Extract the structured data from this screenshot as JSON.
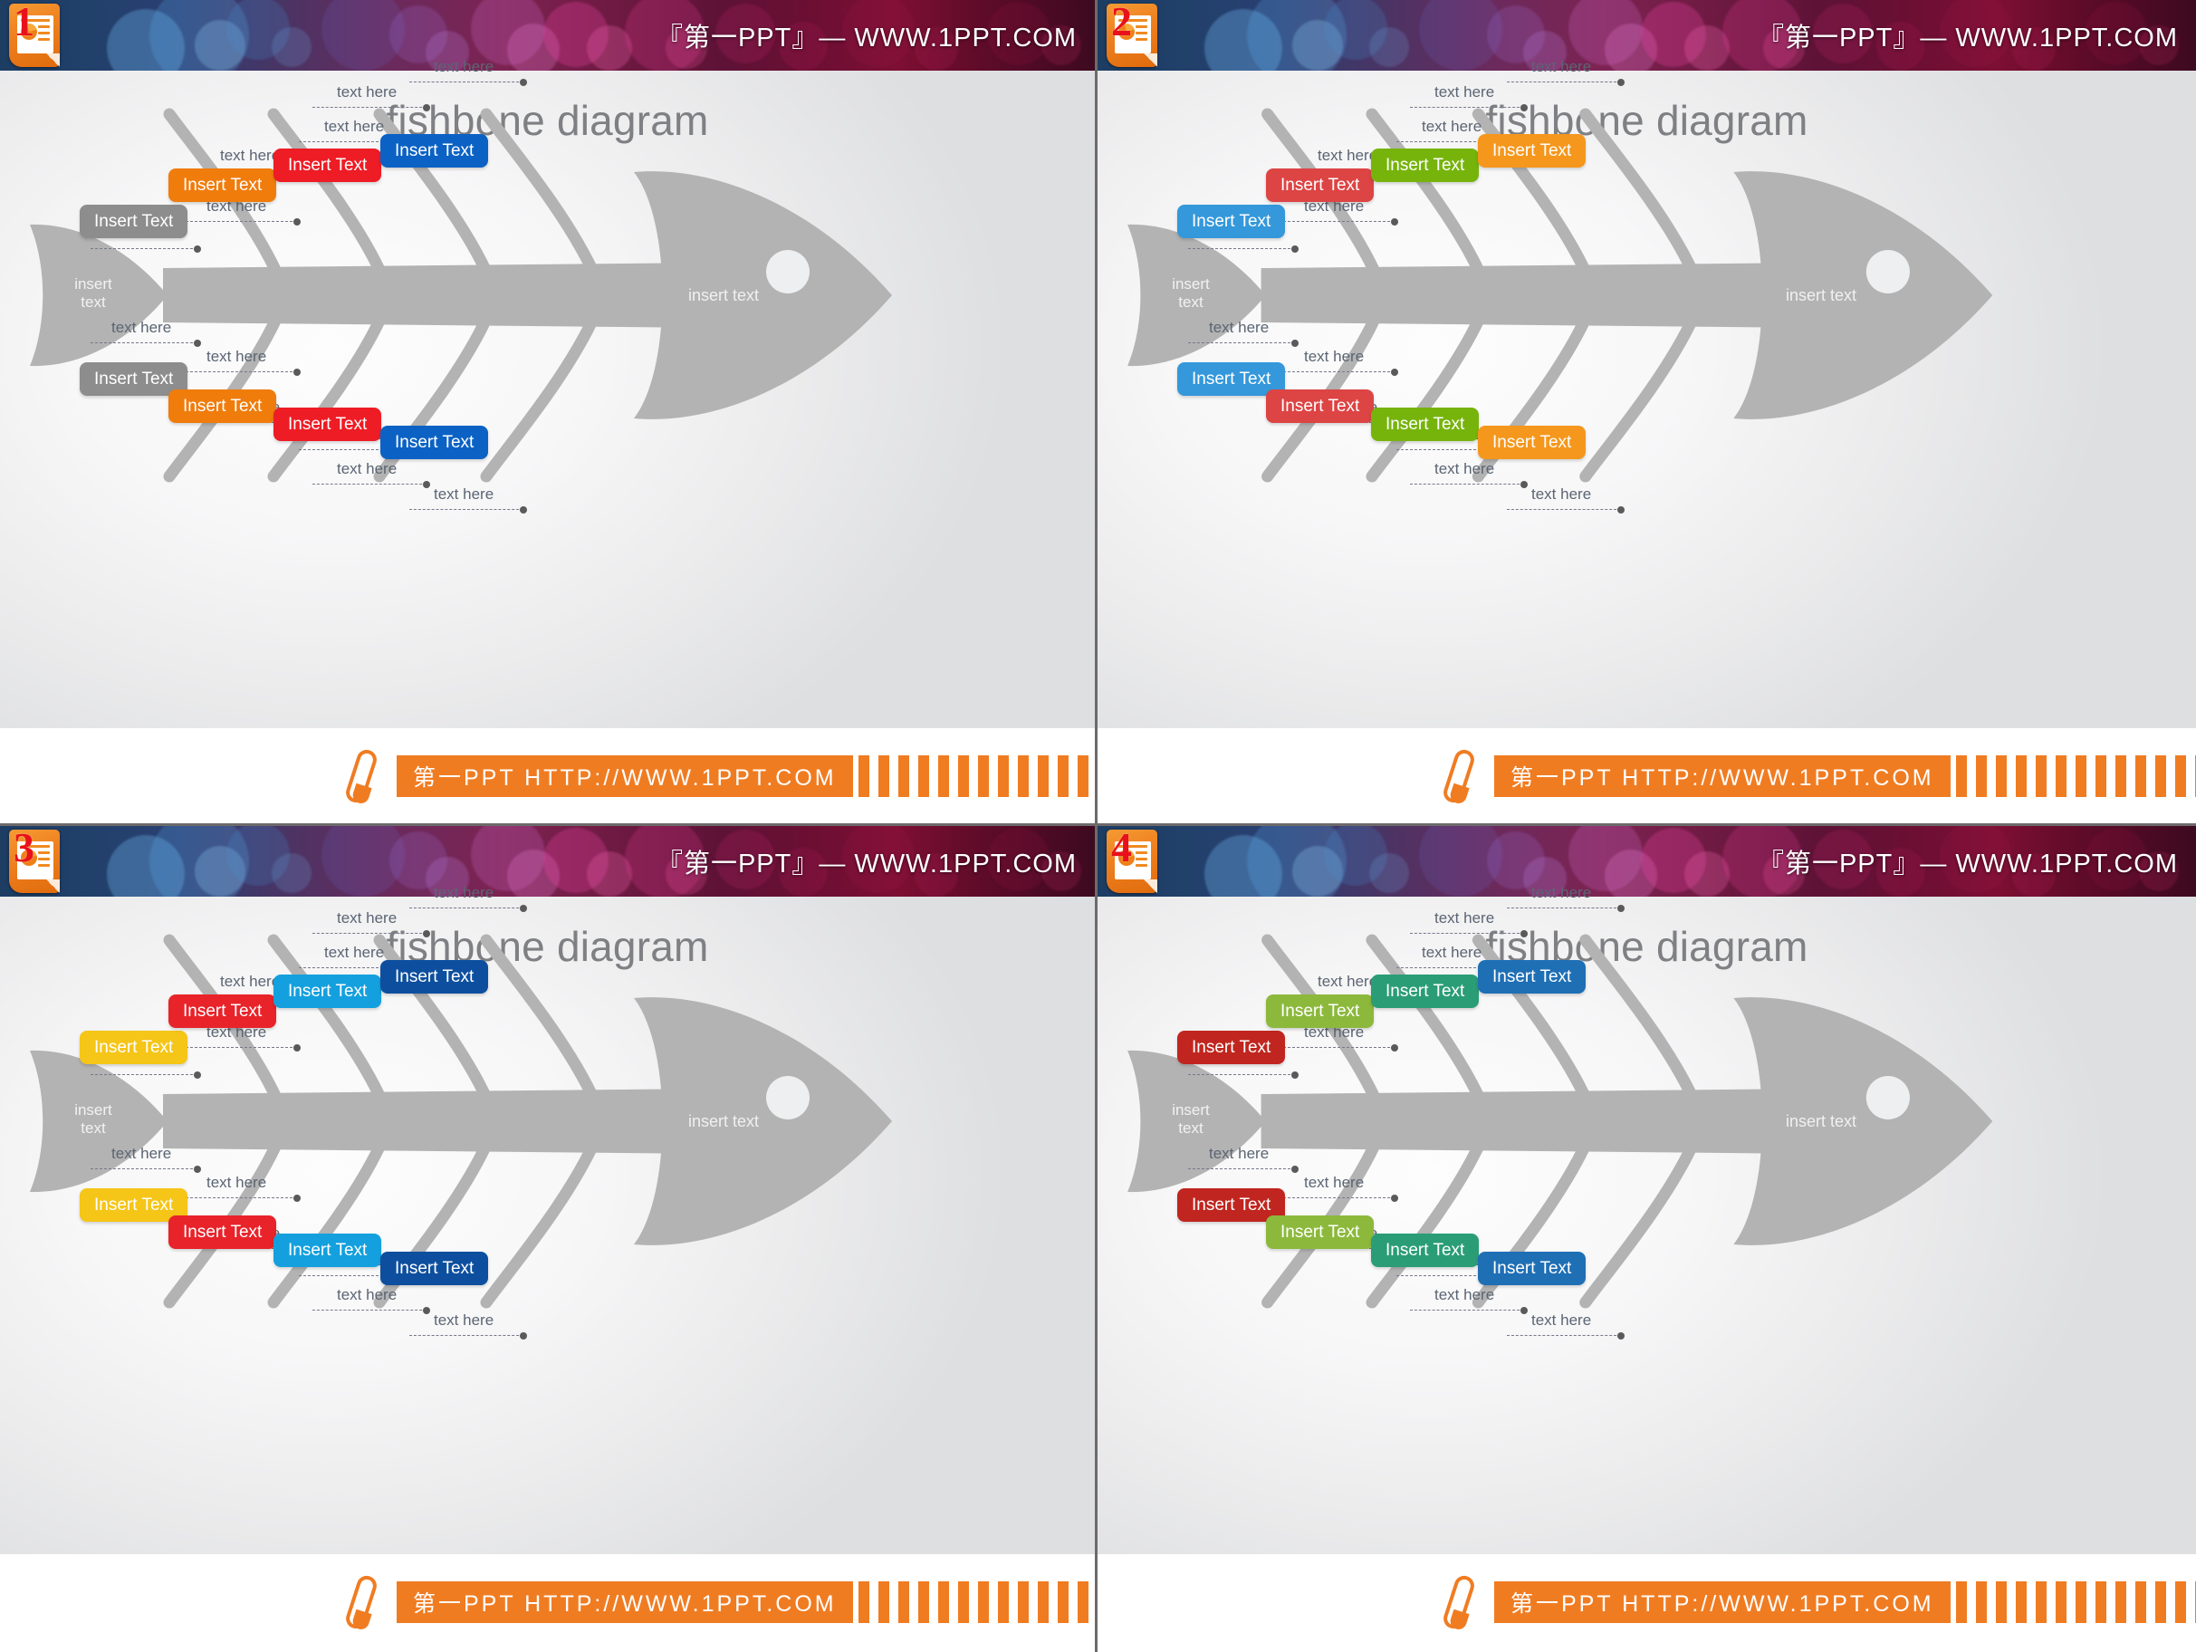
{
  "header": {
    "brand_text": "『第一PPT』— WWW.1PPT.COM",
    "icon_name": "powerpoint-file-icon",
    "badge_numbers": [
      "1",
      "2",
      "3",
      "4"
    ]
  },
  "footer": {
    "pen_icon_name": "pen-icon",
    "bar_text": "第一PPT HTTP://WWW.1PPT.COM"
  },
  "slide": {
    "title": "fishbone diagram",
    "head_text": "insert text",
    "tail_text_line1": "insert",
    "tail_text_line2": "text",
    "chip_label": "Insert Text",
    "leader_label": "text here"
  },
  "colors": {
    "spine_gray": "#b3b3b3",
    "label_gray": "#5b6573",
    "title_gray": "#7f8083",
    "accent_orange": "#f07c22",
    "badge_red": "#e8111b",
    "divider_gray": "#6e6a6b"
  },
  "panels": [
    {
      "index": 1,
      "badge": "1",
      "title": "fishbone diagram",
      "chips_top": [
        {
          "label": "Insert Text",
          "color": "#8d8d8d"
        },
        {
          "label": "Insert Text",
          "color": "#f07c0c"
        },
        {
          "label": "Insert Text",
          "color": "#ee1c25"
        },
        {
          "label": "Insert Text",
          "color": "#0b62c4"
        }
      ],
      "chips_bottom": [
        {
          "label": "Insert Text",
          "color": "#8d8d8d"
        },
        {
          "label": "Insert Text",
          "color": "#f07c0c"
        },
        {
          "label": "Insert Text",
          "color": "#ee1c25"
        },
        {
          "label": "Insert Text",
          "color": "#0b62c4"
        }
      ]
    },
    {
      "index": 2,
      "badge": "2",
      "title": "fishbone diagram",
      "chips_top": [
        {
          "label": "Insert Text",
          "color": "#3498db"
        },
        {
          "label": "Insert Text",
          "color": "#dd4444"
        },
        {
          "label": "Insert Text",
          "color": "#76b40c"
        },
        {
          "label": "Insert Text",
          "color": "#f5971d"
        }
      ],
      "chips_bottom": [
        {
          "label": "Insert Text",
          "color": "#3498db"
        },
        {
          "label": "Insert Text",
          "color": "#dd4444"
        },
        {
          "label": "Insert Text",
          "color": "#76b40c"
        },
        {
          "label": "Insert Text",
          "color": "#f5971d"
        }
      ]
    },
    {
      "index": 3,
      "badge": "3",
      "title": "fishbone diagram",
      "chips_top": [
        {
          "label": "Insert Text",
          "color": "#f5c518"
        },
        {
          "label": "Insert Text",
          "color": "#e8232a"
        },
        {
          "label": "Insert Text",
          "color": "#14a0de"
        },
        {
          "label": "Insert Text",
          "color": "#0d4f9e"
        }
      ],
      "chips_bottom": [
        {
          "label": "Insert Text",
          "color": "#f5c518"
        },
        {
          "label": "Insert Text",
          "color": "#e8232a"
        },
        {
          "label": "Insert Text",
          "color": "#14a0de"
        },
        {
          "label": "Insert Text",
          "color": "#0d4f9e"
        }
      ]
    },
    {
      "index": 4,
      "badge": "4",
      "title": "fishbone diagram",
      "chips_top": [
        {
          "label": "Insert Text",
          "color": "#c0261f"
        },
        {
          "label": "Insert Text",
          "color": "#8cb93c"
        },
        {
          "label": "Insert Text",
          "color": "#2a9d76"
        },
        {
          "label": "Insert Text",
          "color": "#1f6fb5"
        }
      ],
      "chips_bottom": [
        {
          "label": "Insert Text",
          "color": "#c0261f"
        },
        {
          "label": "Insert Text",
          "color": "#8cb93c"
        },
        {
          "label": "Insert Text",
          "color": "#2a9d76"
        },
        {
          "label": "Insert Text",
          "color": "#1f6fb5"
        }
      ]
    }
  ]
}
